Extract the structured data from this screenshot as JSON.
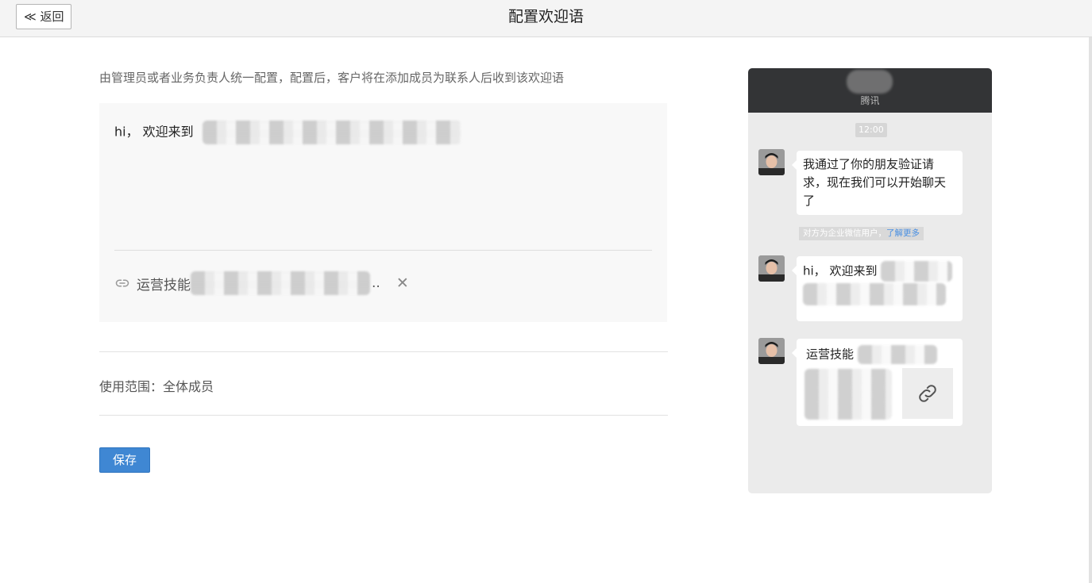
{
  "header": {
    "back_label": "≪ 返回",
    "title": "配置欢迎语"
  },
  "form": {
    "description": "由管理员或者业务负责人统一配置，配置后，客户将在添加成员为联系人后收到该欢迎语",
    "message_prefix": "hi，  欢迎来到",
    "attachment_title_prefix": "运营技能",
    "attachment_ellipsis": "..",
    "remove_symbol": "✕",
    "scope_text": "使用范围：全体成员",
    "save_label": "保存"
  },
  "preview": {
    "contact_name": "腾讯",
    "time": "12:00",
    "friend_message": "我通过了你的朋友验证请求，现在我们可以开始聊天了",
    "notice_text": "对方为企业微信用户，",
    "notice_link": "了解更多",
    "welcome_prefix": "hi，  欢迎来到",
    "card_title_prefix": "运营技能"
  },
  "colors": {
    "primary": "#3f87d3",
    "phone_header": "#333436",
    "link": "#4a90e2"
  }
}
